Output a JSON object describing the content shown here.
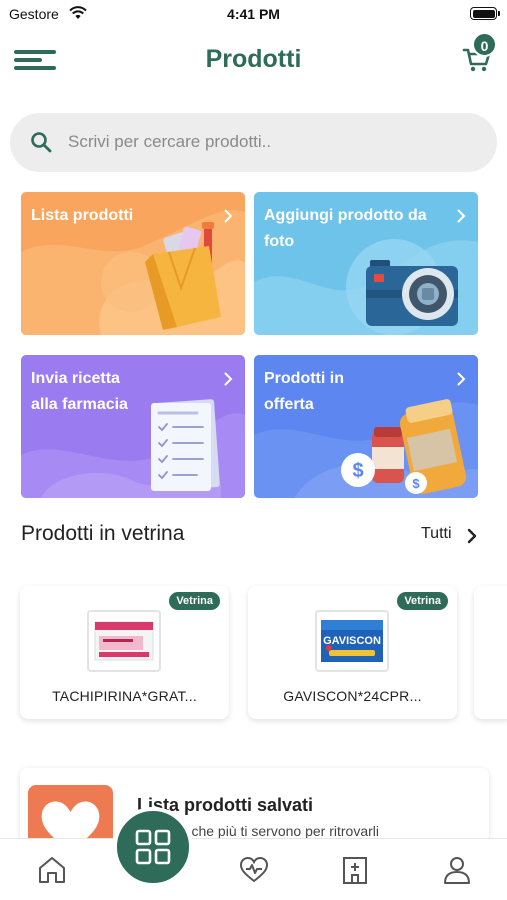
{
  "status_bar": {
    "carrier": "Gestore",
    "time": "4:41 PM"
  },
  "header": {
    "title": "Prodotti",
    "cart_count": "0"
  },
  "search": {
    "placeholder": "Scrivi per cercare prodotti.."
  },
  "tiles": [
    {
      "label": "Lista prodotti",
      "color": "#f9a55e"
    },
    {
      "label": "Aggiungi prodotto da foto",
      "color": "#6ec3ea"
    },
    {
      "label": "Invia ricetta alla farmacia",
      "color": "#9b7cf0"
    },
    {
      "label": "Prodotti in offerta",
      "color": "#5d86f0"
    }
  ],
  "showcase": {
    "title": "Prodotti in vetrina",
    "see_all": "Tutti",
    "products": [
      {
        "badge": "Vetrina",
        "name": "TACHIPIRINA*GRAT..."
      },
      {
        "badge": "Vetrina",
        "name": "GAVISCON*24CPR..."
      }
    ]
  },
  "saved_list": {
    "title": "Lista prodotti salvati",
    "subtitle": "...rodotti che più ti servono per ritrovarli"
  },
  "colors": {
    "brand": "#2e6b58",
    "search_bg": "#ededed",
    "saved_accent": "#ee7a52"
  },
  "bottom_nav": [
    "home-icon",
    "grid-icon",
    "heart-pulse-icon",
    "pharmacy-icon",
    "profile-icon"
  ]
}
